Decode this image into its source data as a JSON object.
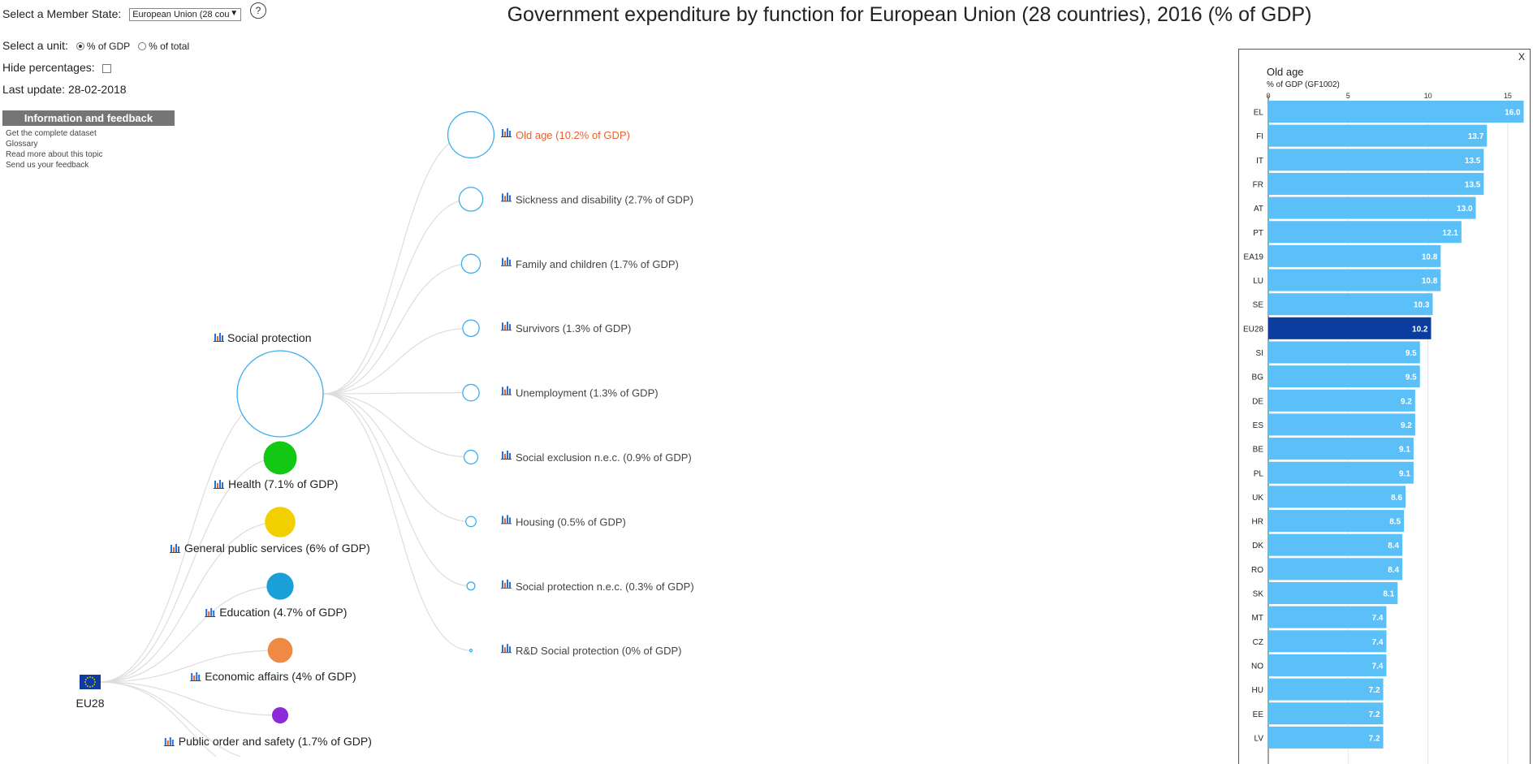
{
  "controls": {
    "member_state_label": "Select a Member State:",
    "member_state_value": "European Union (28 cou",
    "help": "?",
    "unit_label": "Select a unit:",
    "unit_options": [
      "% of GDP",
      "% of total"
    ],
    "unit_selected": "% of GDP",
    "hide_label": "Hide percentages:",
    "last_update": "Last update: 28-02-2018"
  },
  "info": {
    "header": "Information and feedback",
    "links": [
      "Get the complete dataset",
      "Glossary",
      "Read more about this topic",
      "Send us your feedback"
    ]
  },
  "title": "Government expenditure by function for European Union (28 countries), 2016 (% of GDP)",
  "tree": {
    "root": "EU28",
    "expanded": "Social protection",
    "functions": [
      {
        "label": "Health (7.1% of GDP)",
        "value": 7.1,
        "color": "#13c813"
      },
      {
        "label": "General public services (6% of GDP)",
        "value": 6,
        "color": "#f2d000"
      },
      {
        "label": "Education (4.7% of GDP)",
        "value": 4.7,
        "color": "#1a9fd6"
      },
      {
        "label": "Economic affairs (4% of GDP)",
        "value": 4,
        "color": "#ef8a45"
      },
      {
        "label": "Public order and safety (1.7% of GDP)",
        "value": 1.7,
        "color": "#8b2ad6"
      }
    ],
    "sub": [
      {
        "label": "Old age (10.2% of GDP)",
        "value": 10.2,
        "active": true
      },
      {
        "label": "Sickness and disability (2.7% of GDP)",
        "value": 2.7
      },
      {
        "label": "Family and children (1.7% of GDP)",
        "value": 1.7
      },
      {
        "label": "Survivors (1.3% of GDP)",
        "value": 1.3
      },
      {
        "label": "Unemployment (1.3% of GDP)",
        "value": 1.3
      },
      {
        "label": "Social exclusion n.e.c. (0.9% of GDP)",
        "value": 0.9
      },
      {
        "label": "Housing (0.5% of GDP)",
        "value": 0.5
      },
      {
        "label": "Social protection n.e.c. (0.3% of GDP)",
        "value": 0.3
      },
      {
        "label": "R&D Social protection (0% of GDP)",
        "value": 0
      }
    ],
    "active_color": "#e8612c",
    "node_color": "#3daeef"
  },
  "panel": {
    "close": "X",
    "title": "Old age",
    "unit": "% of GDP (GF1002)"
  },
  "chart_data": {
    "type": "bar",
    "orientation": "horizontal",
    "title": "Old age",
    "xlabel": "% of GDP (GF1002)",
    "xlim": [
      0,
      16.1
    ],
    "xticks": [
      0,
      5,
      10,
      15
    ],
    "grid": true,
    "highlight": "EU28",
    "bar_color": "#5bc0f8",
    "highlight_color": "#0a3d9e",
    "categories": [
      "EL",
      "FI",
      "IT",
      "FR",
      "AT",
      "PT",
      "EA19",
      "LU",
      "SE",
      "EU28",
      "SI",
      "BG",
      "DE",
      "ES",
      "BE",
      "PL",
      "UK",
      "HR",
      "DK",
      "RO",
      "SK",
      "MT",
      "CZ",
      "NO",
      "HU",
      "EE",
      "LV"
    ],
    "values": [
      16.0,
      13.7,
      13.5,
      13.5,
      13.0,
      12.1,
      10.8,
      10.8,
      10.3,
      10.2,
      9.5,
      9.5,
      9.2,
      9.2,
      9.1,
      9.1,
      8.6,
      8.5,
      8.4,
      8.4,
      8.1,
      7.4,
      7.4,
      7.4,
      7.2,
      7.2,
      7.2
    ],
    "value_labels": [
      "16.0",
      "13.7",
      "13.5",
      "13.5",
      "13.0",
      "12.1",
      "10.8",
      "10.8",
      "10.3",
      "10.2",
      "9.5",
      "9.5",
      "9.2",
      "9.2",
      "9.1",
      "9.1",
      "8.6",
      "8.5",
      "8.4",
      "8.4",
      "8.1",
      "7.4",
      "7.4",
      "7.4",
      "7.2",
      "7.2",
      "7.2"
    ]
  }
}
